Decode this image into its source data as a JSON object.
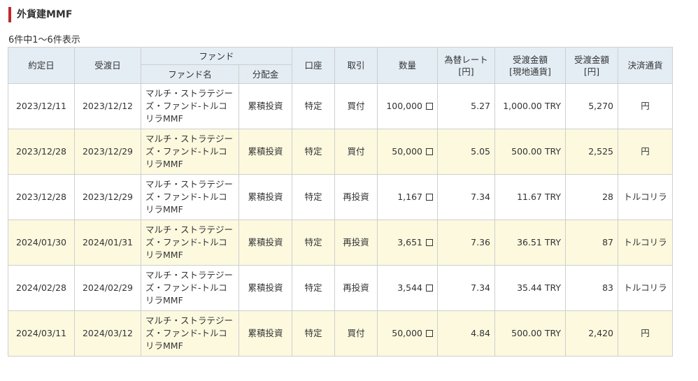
{
  "title": "外貨建MMF",
  "count_text": "6件中1～6件表示",
  "headers": {
    "trade_date": "約定日",
    "settle_date": "受渡日",
    "fund_group": "ファンド",
    "fund_name": "ファンド名",
    "distribution": "分配金",
    "account": "口座",
    "trade_type": "取引",
    "quantity": "数量",
    "fx_rate_l1": "為替レート",
    "fx_rate_l2": "[円]",
    "amount_local_l1": "受渡金額",
    "amount_local_l2": "[現地通貨]",
    "amount_jpy_l1": "受渡金額",
    "amount_jpy_l2": "[円]",
    "settle_currency": "決済通貨"
  },
  "rows": [
    {
      "trade_date": "2023/12/11",
      "settle_date": "2023/12/12",
      "fund_name": "マルチ・ストラテジーズ・ファンド-トルコリラMMF",
      "distribution": "累積投資",
      "account": "特定",
      "trade_type": "買付",
      "quantity": "100,000",
      "fx_rate": "5.27",
      "amount_local": "1,000.00 TRY",
      "amount_jpy": "5,270",
      "settle_currency": "円"
    },
    {
      "trade_date": "2023/12/28",
      "settle_date": "2023/12/29",
      "fund_name": "マルチ・ストラテジーズ・ファンド-トルコリラMMF",
      "distribution": "累積投資",
      "account": "特定",
      "trade_type": "買付",
      "quantity": "50,000",
      "fx_rate": "5.05",
      "amount_local": "500.00 TRY",
      "amount_jpy": "2,525",
      "settle_currency": "円"
    },
    {
      "trade_date": "2023/12/28",
      "settle_date": "2023/12/29",
      "fund_name": "マルチ・ストラテジーズ・ファンド-トルコリラMMF",
      "distribution": "累積投資",
      "account": "特定",
      "trade_type": "再投資",
      "quantity": "1,167",
      "fx_rate": "7.34",
      "amount_local": "11.67 TRY",
      "amount_jpy": "28",
      "settle_currency": "トルコリラ"
    },
    {
      "trade_date": "2024/01/30",
      "settle_date": "2024/01/31",
      "fund_name": "マルチ・ストラテジーズ・ファンド-トルコリラMMF",
      "distribution": "累積投資",
      "account": "特定",
      "trade_type": "再投資",
      "quantity": "3,651",
      "fx_rate": "7.36",
      "amount_local": "36.51 TRY",
      "amount_jpy": "87",
      "settle_currency": "トルコリラ"
    },
    {
      "trade_date": "2024/02/28",
      "settle_date": "2024/02/29",
      "fund_name": "マルチ・ストラテジーズ・ファンド-トルコリラMMF",
      "distribution": "累積投資",
      "account": "特定",
      "trade_type": "再投資",
      "quantity": "3,544",
      "fx_rate": "7.34",
      "amount_local": "35.44 TRY",
      "amount_jpy": "83",
      "settle_currency": "トルコリラ"
    },
    {
      "trade_date": "2024/03/11",
      "settle_date": "2024/03/12",
      "fund_name": "マルチ・ストラテジーズ・ファンド-トルコリラMMF",
      "distribution": "累積投資",
      "account": "特定",
      "trade_type": "買付",
      "quantity": "50,000",
      "fx_rate": "4.84",
      "amount_local": "500.00 TRY",
      "amount_jpy": "2,420",
      "settle_currency": "円"
    }
  ]
}
